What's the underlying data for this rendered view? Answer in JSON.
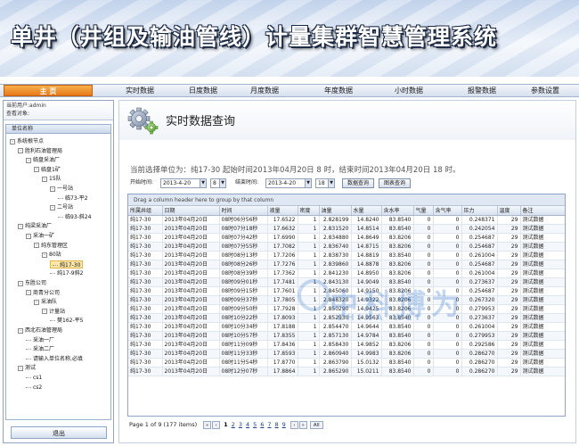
{
  "banner": {
    "title": "单井（井组及输油管线）计量集群智慧管理系统"
  },
  "nav": [
    {
      "label": "主    页",
      "active": true
    },
    {
      "label": "实时数据"
    },
    {
      "label": "日度数据"
    },
    {
      "label": "月度数据"
    },
    {
      "label": "年度数据"
    },
    {
      "label": "小时数据"
    },
    {
      "label": "报警数据"
    },
    {
      "label": "参数设置"
    }
  ],
  "sidebar": {
    "login_user": "当前用户:admin",
    "login_object": "查看对象:",
    "tree_header": "单位名称",
    "tree": [
      {
        "label": "系统根节点",
        "level": 0,
        "toggle": "-"
      },
      {
        "label": "胜利石油管理局",
        "level": 1,
        "toggle": "-"
      },
      {
        "label": "临盘采油厂",
        "level": 2,
        "toggle": "-"
      },
      {
        "label": "临盘1矿",
        "level": 3,
        "toggle": "-"
      },
      {
        "label": "15队",
        "level": 4,
        "toggle": "-"
      },
      {
        "label": "一号站",
        "level": 5,
        "toggle": "-"
      },
      {
        "label": "临73-平2",
        "level": 6,
        "toggle": ""
      },
      {
        "label": "二号站",
        "level": 5,
        "toggle": "-"
      },
      {
        "label": "临93-斜24",
        "level": 6,
        "toggle": ""
      },
      {
        "label": "纯梁采油厂",
        "level": 1,
        "toggle": "-"
      },
      {
        "label": "采油一矿",
        "level": 2,
        "toggle": "-"
      },
      {
        "label": "纯东管理区",
        "level": 3,
        "toggle": "-"
      },
      {
        "label": "80站",
        "level": 4,
        "toggle": "-"
      },
      {
        "label": "纯17-30",
        "level": 5,
        "toggle": "",
        "selected": true
      },
      {
        "label": "纯17-9斜2",
        "level": 5,
        "toggle": ""
      },
      {
        "label": "东胜公司",
        "level": 1,
        "toggle": "-"
      },
      {
        "label": "商青分公司",
        "level": 2,
        "toggle": "-"
      },
      {
        "label": "采油队",
        "level": 3,
        "toggle": "-"
      },
      {
        "label": "计量站",
        "level": 4,
        "toggle": "-"
      },
      {
        "label": "樊162-平5",
        "level": 5,
        "toggle": ""
      },
      {
        "label": "西北石油管理局",
        "level": 1,
        "toggle": "-"
      },
      {
        "label": "采油一厂",
        "level": 2,
        "toggle": ""
      },
      {
        "label": "采油二厂",
        "level": 2,
        "toggle": ""
      },
      {
        "label": "请输入单位名称,必填",
        "level": 2,
        "toggle": ""
      },
      {
        "label": "测试",
        "level": 1,
        "toggle": "-"
      },
      {
        "label": "cs1",
        "level": 2,
        "toggle": ""
      },
      {
        "label": "cs2",
        "level": 2,
        "toggle": ""
      }
    ],
    "logout_label": "退出"
  },
  "main": {
    "title": "实时数据查询",
    "info_line": "当前选择单位为：纯17-30 起始时间2013年04月20日 8 时，结束时间2013年04月20日 18 时。",
    "filter": {
      "start_label": "开始时间:",
      "start_date": "2013-4-20",
      "start_hour": "8",
      "end_label": "结束时间:",
      "end_date": "2013-4-20",
      "end_hour": "18",
      "query_button": "数据查询",
      "chart_button": "图表查询"
    },
    "grid": {
      "group_hint": "Drag a column header here to group by that column",
      "columns": [
        "所属井组",
        "日期",
        "时间",
        "液量",
        "密度",
        "油量",
        "水量",
        "含水率",
        "气量",
        "含气率",
        "压力",
        "温度",
        "备注"
      ],
      "rows": [
        [
          "纯17-30",
          "2013年04月20日",
          "08时06分56秒",
          "17.6522",
          "1",
          "2.828199",
          "14.8240",
          "83.8540",
          "0",
          "0",
          "0.248371",
          "29",
          "测试数据"
        ],
        [
          "纯17-30",
          "2013年04月20日",
          "08时07分18秒",
          "17.6632",
          "1",
          "2.831520",
          "14.8514",
          "83.8540",
          "0",
          "0",
          "0.242054",
          "29",
          "测试数据"
        ],
        [
          "纯17-30",
          "2013年04月20日",
          "08时07分42秒",
          "17.6990",
          "1",
          "2.834880",
          "14.8649",
          "83.8206",
          "0",
          "0",
          "0.254687",
          "29",
          "测试数据"
        ],
        [
          "纯17-30",
          "2013年04月20日",
          "08时07分55秒",
          "17.7082",
          "1",
          "2.836740",
          "14.8715",
          "83.8206",
          "0",
          "0",
          "0.254687",
          "29",
          "测试数据"
        ],
        [
          "纯17-30",
          "2013年04月20日",
          "08时08分13秒",
          "17.7206",
          "1",
          "2.838730",
          "14.8819",
          "83.8540",
          "0",
          "0",
          "0.261004",
          "29",
          "测试数据"
        ],
        [
          "纯17-30",
          "2013年04月20日",
          "08时08分26秒",
          "17.7276",
          "1",
          "2.839860",
          "14.8878",
          "83.8206",
          "0",
          "0",
          "0.254687",
          "29",
          "测试数据"
        ],
        [
          "纯17-30",
          "2013年04月20日",
          "08时08分39秒",
          "17.7362",
          "1",
          "2.841230",
          "14.8950",
          "83.8206",
          "0",
          "0",
          "0.261004",
          "29",
          "测试数据"
        ],
        [
          "纯17-30",
          "2013年04月20日",
          "08时09分01秒",
          "17.7481",
          "1",
          "2.843130",
          "14.9049",
          "83.8540",
          "0",
          "0",
          "0.273637",
          "29",
          "测试数据"
        ],
        [
          "纯17-30",
          "2013年04月20日",
          "08时09分15秒",
          "17.7601",
          "1",
          "2.845060",
          "14.9150",
          "83.8206",
          "0",
          "0",
          "0.254687",
          "29",
          "测试数据"
        ],
        [
          "纯17-30",
          "2013年04月20日",
          "08时09分37秒",
          "17.7805",
          "1",
          "2.848320",
          "14.9322",
          "83.8206",
          "0",
          "0",
          "0.267320",
          "29",
          "测试数据"
        ],
        [
          "纯17-30",
          "2013年04月20日",
          "08时09分50秒",
          "17.7928",
          "1",
          "2.850290",
          "14.9425",
          "83.8206",
          "0",
          "0",
          "0.279953",
          "29",
          "测试数据"
        ],
        [
          "纯17-30",
          "2013年04月20日",
          "08时10分22秒",
          "17.8093",
          "1",
          "2.852930",
          "14.9563",
          "83.8540",
          "0",
          "0",
          "0.273637",
          "29",
          "测试数据"
        ],
        [
          "纯17-30",
          "2013年04月20日",
          "08时10分34秒",
          "17.8188",
          "1",
          "2.854470",
          "14.9644",
          "83.8540",
          "0",
          "0",
          "0.261004",
          "29",
          "测试数据"
        ],
        [
          "纯17-30",
          "2013年04月20日",
          "08时10分57秒",
          "17.8355",
          "1",
          "2.857130",
          "14.9784",
          "83.8540",
          "0",
          "0",
          "0.279953",
          "29",
          "测试数据"
        ],
        [
          "纯17-30",
          "2013年04月20日",
          "08时11分09秒",
          "17.8436",
          "1",
          "2.858430",
          "14.9852",
          "83.8206",
          "0",
          "0",
          "0.292586",
          "29",
          "测试数据"
        ],
        [
          "纯17-30",
          "2013年04月20日",
          "08时11分33秒",
          "17.8593",
          "1",
          "2.860940",
          "14.9983",
          "83.8206",
          "0",
          "0",
          "0.286270",
          "29",
          "测试数据"
        ],
        [
          "纯17-30",
          "2013年04月20日",
          "08时11分54秒",
          "17.8770",
          "1",
          "2.863790",
          "15.0132",
          "83.8540",
          "0",
          "0",
          "0.286270",
          "29",
          "测试数据"
        ],
        [
          "纯17-30",
          "2013年04月20日",
          "08时12分07秒",
          "17.8864",
          "1",
          "2.865290",
          "15.0211",
          "83.8540",
          "0",
          "0",
          "0.286270",
          "29",
          "测试数据"
        ]
      ]
    },
    "pager": {
      "summary": "Page 1 of 9 (177 items)",
      "prev_first": "«",
      "prev": "‹",
      "pages": [
        "1",
        "2",
        "3",
        "4",
        "5",
        "6",
        "7",
        "8",
        "9"
      ],
      "current": "1",
      "next": "›",
      "next_last": "»",
      "all_label": "All"
    },
    "watermark": {
      "text": "中科博为",
      "sub": "CHINA WEI"
    }
  }
}
